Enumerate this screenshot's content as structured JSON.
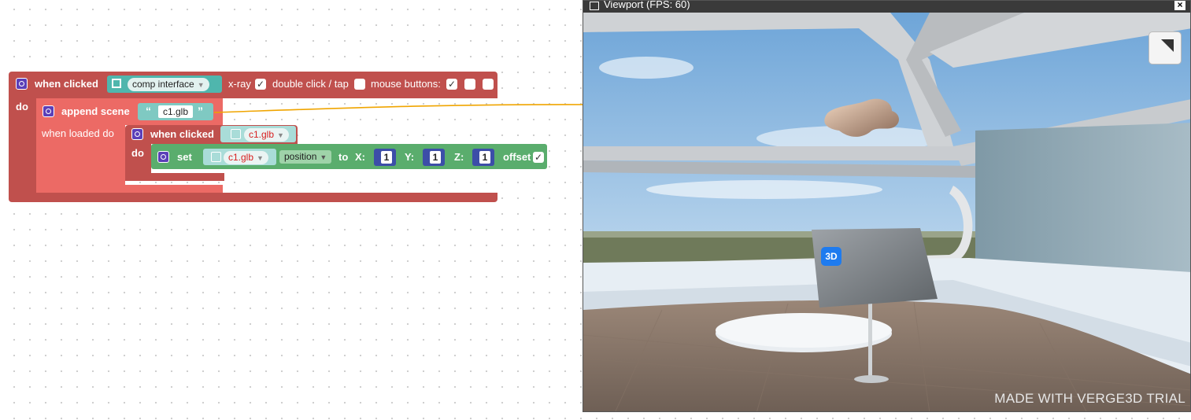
{
  "blocks": {
    "event": {
      "label": "when clicked",
      "object": "comp interface",
      "xray_label": "x-ray",
      "dblclick_label": "double click / tap",
      "mouse_label": "mouse buttons:",
      "do_label": "do"
    },
    "append": {
      "label": "append scene",
      "file": "c1.glb",
      "loaded_label": "when loaded do"
    },
    "inner_event": {
      "label": "when clicked",
      "object": "c1.glb",
      "do_label": "do"
    },
    "set": {
      "label": "set",
      "object": "c1.glb",
      "property": "position",
      "to_label": "to",
      "x_label": "X:",
      "x_value": "1",
      "y_label": "Y:",
      "y_value": "1",
      "z_label": "Z:",
      "z_value": "1",
      "offset_label": "offset"
    }
  },
  "viewport": {
    "title": "Viewport (FPS: 60)",
    "close_symbol": "×",
    "badge": "3D",
    "watermark": "MADE WITH VERGE3D TRIAL"
  },
  "colors": {
    "event_block": "#c0504d",
    "append_block": "#ec6a65",
    "set_block": "#5aad6d",
    "connector_line": "#f0a500"
  }
}
